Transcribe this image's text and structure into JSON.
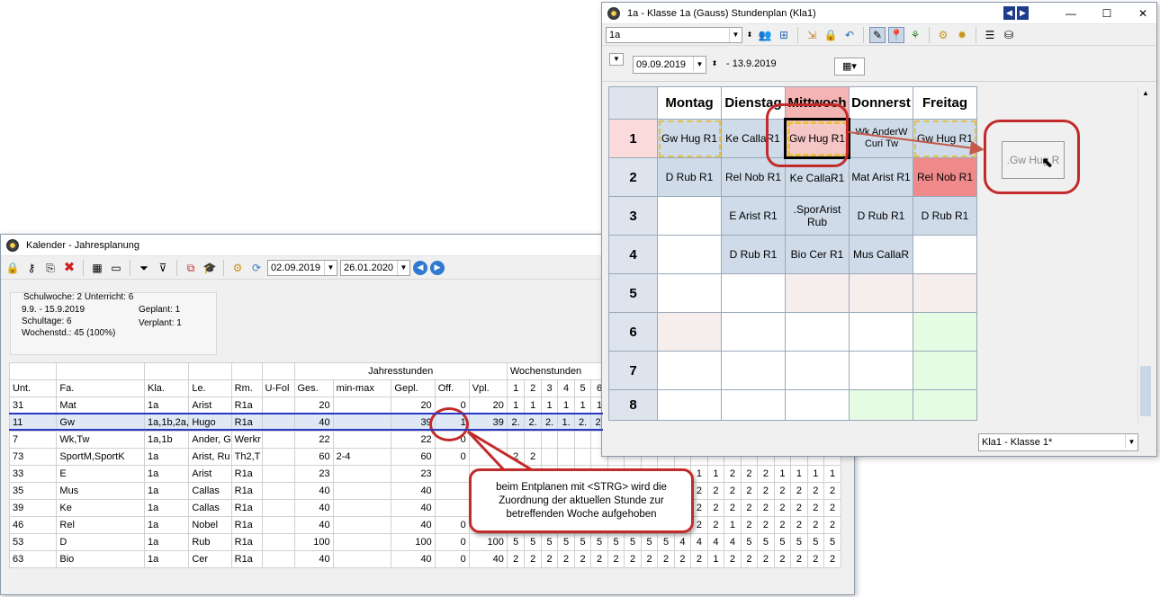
{
  "left_window": {
    "title": "Kalender - Jahresplanung",
    "date_from": "02.09.2019",
    "date_to": "26.01.2020",
    "info": {
      "week_line": "Schulwoche: 2  Unterricht: 6",
      "range": "9.9. - 15.9.2019",
      "schooldays": "Schultage: 6",
      "weekhours": "Wochenstd.: 45 (100%)",
      "planned": "Geplant: 1",
      "unplanned": "Verplant: 1"
    },
    "group_headers": {
      "jahres": "Jahresstunden",
      "wochen": "Wochenstunden"
    },
    "columns": [
      "Unt.",
      "Fa.",
      "Kla.",
      "Le.",
      "Rm.",
      "U-Fol",
      "Ges.",
      "min-max",
      "Gepl.",
      "Off.",
      "Vpl."
    ],
    "week_numbers": [
      "1",
      "2",
      "3",
      "4",
      "5",
      "6"
    ],
    "rows": [
      {
        "unt": "31",
        "fa": "Mat",
        "kla": "1a",
        "le": "Arist",
        "rm": "R1a",
        "ufol": "",
        "ges": "20",
        "minmax": "",
        "gepl": "20",
        "off": "0",
        "vpl": "20",
        "w": [
          "1",
          "1",
          "1",
          "1",
          "1",
          "1"
        ],
        "ext": []
      },
      {
        "unt": "11",
        "fa": "Gw",
        "kla": "1a,1b,2a,",
        "le": "Hugo",
        "rm": "R1a",
        "ufol": "",
        "ges": "40",
        "minmax": "",
        "gepl": "39",
        "off": "1",
        "vpl": "39",
        "w": [
          "2.",
          "2.",
          "2.",
          "1.",
          "2.",
          "2."
        ],
        "ext": []
      },
      {
        "unt": "7",
        "fa": "Wk,Tw",
        "kla": "1a,1b",
        "le": "Ander, G",
        "rm": "Werkr",
        "ufol": "",
        "ges": "22",
        "minmax": "",
        "gepl": "22",
        "off": "0",
        "vpl": "",
        "w": [],
        "ext": []
      },
      {
        "unt": "73",
        "fa": "SportM,SportK",
        "kla": "1a",
        "le": "Arist, Ru",
        "rm": "Th2,T",
        "ufol": "",
        "ges": "60",
        "minmax": "2-4",
        "gepl": "60",
        "off": "0",
        "vpl": "60",
        "w": [
          "2",
          "2"
        ],
        "ext": []
      },
      {
        "unt": "33",
        "fa": "E",
        "kla": "1a",
        "le": "Arist",
        "rm": "R1a",
        "ufol": "",
        "ges": "23",
        "minmax": "",
        "gepl": "23",
        "off": "",
        "vpl": "",
        "w": [],
        "ext": [
          "1",
          "1",
          "1",
          "2",
          "2",
          "2",
          "1",
          "1",
          "1",
          "1"
        ]
      },
      {
        "unt": "35",
        "fa": "Mus",
        "kla": "1a",
        "le": "Callas",
        "rm": "R1a",
        "ufol": "",
        "ges": "40",
        "minmax": "",
        "gepl": "40",
        "off": "",
        "vpl": "",
        "w": [],
        "ext": [
          "2",
          "2",
          "2",
          "2",
          "2",
          "2",
          "2",
          "2",
          "2",
          "2"
        ]
      },
      {
        "unt": "39",
        "fa": "Ke",
        "kla": "1a",
        "le": "Callas",
        "rm": "R1a",
        "ufol": "",
        "ges": "40",
        "minmax": "",
        "gepl": "40",
        "off": "",
        "vpl": "",
        "w": [],
        "ext": [
          "2",
          "2",
          "2",
          "2",
          "2",
          "2",
          "2",
          "2",
          "2",
          "2"
        ]
      },
      {
        "unt": "46",
        "fa": "Rel",
        "kla": "1a",
        "le": "Nobel",
        "rm": "R1a",
        "ufol": "",
        "ges": "40",
        "minmax": "",
        "gepl": "40",
        "off": "0",
        "vpl": "",
        "w": [],
        "ext": [
          "2",
          "2",
          "2",
          "1",
          "2",
          "2",
          "2",
          "2",
          "2",
          "2"
        ]
      },
      {
        "unt": "53",
        "fa": "D",
        "kla": "1a",
        "le": "Rub",
        "rm": "R1a",
        "ufol": "",
        "ges": "100",
        "minmax": "",
        "gepl": "100",
        "off": "0",
        "vpl": "100",
        "w": [
          "5",
          "5",
          "5",
          "5",
          "5",
          "5"
        ],
        "ext": [
          "5",
          "5",
          "5",
          "5",
          "4",
          "4",
          "4",
          "4",
          "5",
          "5",
          "5",
          "5",
          "5",
          "5"
        ]
      },
      {
        "unt": "63",
        "fa": "Bio",
        "kla": "1a",
        "le": "Cer",
        "rm": "R1a",
        "ufol": "",
        "ges": "40",
        "minmax": "",
        "gepl": "40",
        "off": "0",
        "vpl": "40",
        "w": [
          "2",
          "2",
          "2",
          "2",
          "2",
          "2"
        ],
        "ext": [
          "2",
          "2",
          "2",
          "2",
          "2",
          "2",
          "1",
          "2",
          "2",
          "2",
          "2",
          "2",
          "2",
          "2"
        ]
      }
    ]
  },
  "right_window": {
    "title": "1a - Klasse 1a (Gauss)  Stundenplan  (Kla1)",
    "class_combo": "1a",
    "date": "09.09.2019",
    "date_end": "- 13.9.2019",
    "days": [
      "Montag",
      "Dienstag",
      "Mittwoch",
      "Donnerst",
      "Freitag"
    ],
    "periods": [
      "1",
      "2",
      "3",
      "4",
      "5",
      "6",
      "7",
      "8"
    ],
    "cells": [
      [
        "Gw Hug  R1",
        "Ke  CallaR1",
        "Gw Hug  R1",
        "Wk AnderW Curi  Tw",
        "Gw Hug  R1"
      ],
      [
        "D  Rub  R1",
        "Rel Nob  R1",
        "Ke  CallaR1",
        "Mat Arist R1",
        "Rel Nob  R1"
      ],
      [
        "",
        "E  Arist R1",
        ".SporArist Rub",
        "D  Rub  R1",
        "D  Rub  R1"
      ],
      [
        "",
        "D  Rub  R1",
        "Bio Cer  R1",
        "Mus CallaR",
        ""
      ],
      [
        "",
        "",
        "",
        "",
        ""
      ],
      [
        "",
        "",
        "",
        "",
        ""
      ],
      [
        "",
        "",
        "",
        "",
        ""
      ],
      [
        "",
        "",
        "",
        "",
        ""
      ]
    ],
    "drag_label": ".Gw Hug  R",
    "bottom_combo": "Kla1 - Klasse 1*"
  },
  "callout": {
    "text": "beim Entplanen mit <STRG> wird die Zuordnung der aktuellen Stunde zur betreffenden Woche aufgehoben"
  },
  "colors": {
    "highlight_red": "#c32b2b",
    "selected_row": "#dfe8f5",
    "cell_blue": "#cfdbe9",
    "cell_red": "#f08a8a",
    "cell_green": "#e4fbe4"
  }
}
